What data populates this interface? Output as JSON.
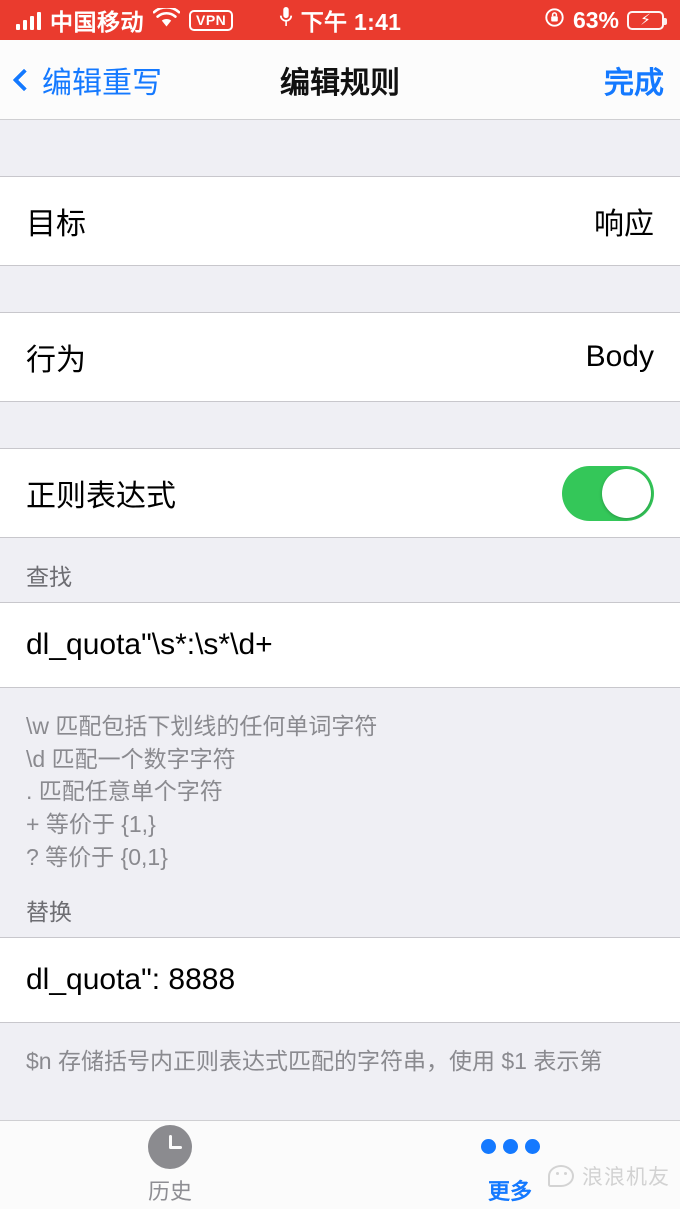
{
  "status_bar": {
    "carrier": "中国移动",
    "vpn_label": "VPN",
    "time": "下午 1:41",
    "battery_percent": "63%",
    "battery_level": 63,
    "background_color": "#ea3b2e",
    "icons": [
      "signal-bars-icon",
      "wifi-icon",
      "vpn-badge",
      "microphone-icon",
      "rotation-lock-icon",
      "battery-charging-icon"
    ]
  },
  "nav_bar": {
    "back_label": "编辑重写",
    "title": "编辑规则",
    "done_label": "完成",
    "tint_color": "#1479ff"
  },
  "settings": {
    "target_row": {
      "label": "目标",
      "value": "响应"
    },
    "action_row": {
      "label": "行为",
      "value": "Body"
    },
    "regex_row": {
      "label": "正则表达式",
      "toggle_on": true,
      "toggle_color": "#34c759"
    }
  },
  "find_section": {
    "header": "查找",
    "value": "dl_quota\"\\s*:\\s*\\d+",
    "footer_lines": [
      "\\w 匹配包括下划线的任何单词字符",
      "\\d 匹配一个数字字符",
      ". 匹配任意单个字符",
      "+ 等价于 {1,}",
      "? 等价于 {0,1}"
    ]
  },
  "replace_section": {
    "header": "替换",
    "value": "dl_quota\": 8888",
    "footer_lines": [
      "$n 存储括号内正则表达式匹配的字符串，使用 $1 表示第"
    ]
  },
  "tab_bar": {
    "tabs": [
      {
        "label": "历史",
        "icon": "clock-icon",
        "active": false
      },
      {
        "label": "更多",
        "icon": "ellipsis-icon",
        "active": true
      }
    ],
    "active_color": "#1479ff",
    "inactive_color": "#8e8e93"
  },
  "watermark": {
    "text": "浪浪机友",
    "icon": "wechat-logo-icon"
  }
}
